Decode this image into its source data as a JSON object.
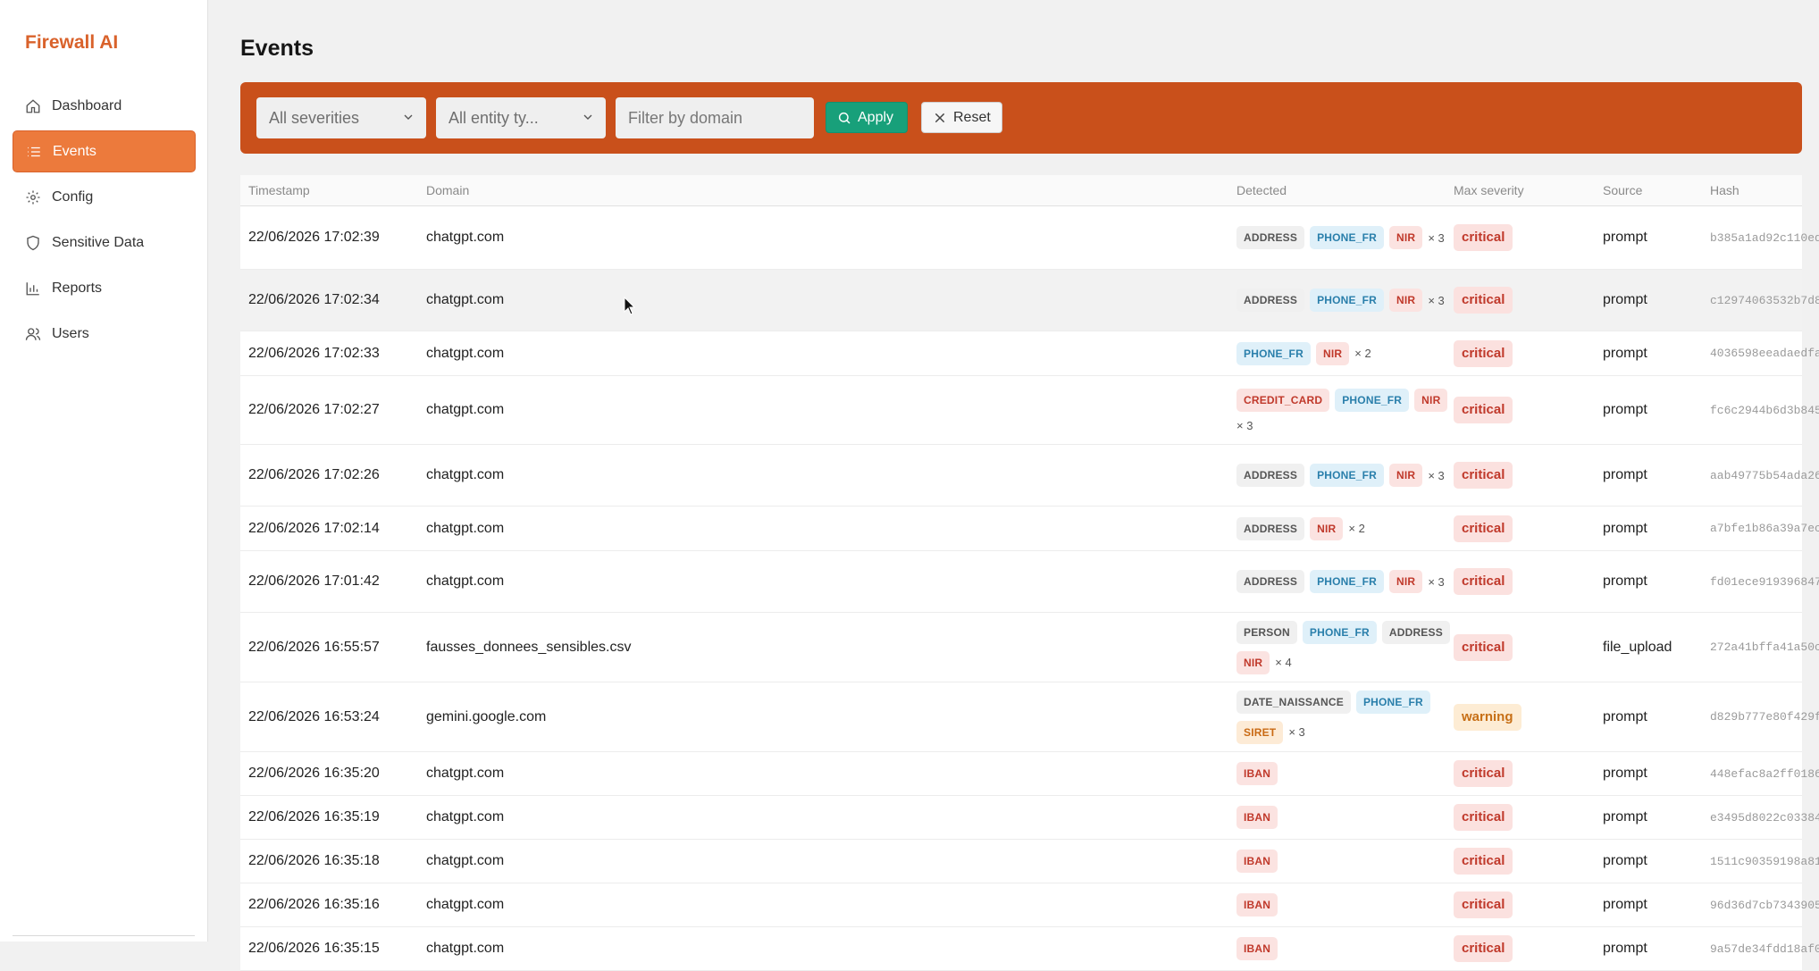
{
  "app": {
    "brand": "Firewall AI"
  },
  "sidebar": {
    "items": [
      {
        "label": "Dashboard",
        "icon": "home-icon",
        "active": false
      },
      {
        "label": "Events",
        "icon": "list-icon",
        "active": true
      },
      {
        "label": "Config",
        "icon": "gear-icon",
        "active": false
      },
      {
        "label": "Sensitive Data",
        "icon": "shield-icon",
        "active": false
      },
      {
        "label": "Reports",
        "icon": "bar-chart-icon",
        "active": false
      },
      {
        "label": "Users",
        "icon": "users-icon",
        "active": false
      }
    ]
  },
  "page": {
    "title": "Events"
  },
  "filters": {
    "severity_select": "All severities",
    "entity_select": "All entity ty...",
    "domain_placeholder": "Filter by domain",
    "apply_label": "Apply",
    "reset_label": "Reset"
  },
  "table": {
    "headers": {
      "timestamp": "Timestamp",
      "domain": "Domain",
      "detected": "Detected",
      "severity": "Max severity",
      "source": "Source",
      "hash": "Hash"
    },
    "rows": [
      {
        "timestamp": "22/06/2026 17:02:39",
        "domain": "chatgpt.com",
        "tags": [
          "ADDRESS",
          "PHONE_FR",
          "NIR"
        ],
        "count": "× 3",
        "severity": "critical",
        "source": "prompt",
        "hash": "b385a1ad92c110ed"
      },
      {
        "timestamp": "22/06/2026 17:02:34",
        "domain": "chatgpt.com",
        "tags": [
          "ADDRESS",
          "PHONE_FR",
          "NIR"
        ],
        "count": "× 3",
        "severity": "critical",
        "source": "prompt",
        "hash": "c12974063532b7d8"
      },
      {
        "timestamp": "22/06/2026 17:02:33",
        "domain": "chatgpt.com",
        "tags": [
          "PHONE_FR",
          "NIR"
        ],
        "count": "× 2",
        "severity": "critical",
        "source": "prompt",
        "hash": "4036598eeadaedfa"
      },
      {
        "timestamp": "22/06/2026 17:02:27",
        "domain": "chatgpt.com",
        "tags": [
          "CREDIT_CARD",
          "PHONE_FR",
          "NIR"
        ],
        "count": "× 3",
        "severity": "critical",
        "source": "prompt",
        "hash": "fc6c2944b6d3b845"
      },
      {
        "timestamp": "22/06/2026 17:02:26",
        "domain": "chatgpt.com",
        "tags": [
          "ADDRESS",
          "PHONE_FR",
          "NIR"
        ],
        "count": "× 3",
        "severity": "critical",
        "source": "prompt",
        "hash": "aab49775b54ada26"
      },
      {
        "timestamp": "22/06/2026 17:02:14",
        "domain": "chatgpt.com",
        "tags": [
          "ADDRESS",
          "NIR"
        ],
        "count": "× 2",
        "severity": "critical",
        "source": "prompt",
        "hash": "a7bfe1b86a39a7ec"
      },
      {
        "timestamp": "22/06/2026 17:01:42",
        "domain": "chatgpt.com",
        "tags": [
          "ADDRESS",
          "PHONE_FR",
          "NIR"
        ],
        "count": "× 3",
        "severity": "critical",
        "source": "prompt",
        "hash": "fd01ece919396847"
      },
      {
        "timestamp": "22/06/2026 16:55:57",
        "domain": "fausses_donnees_sensibles.csv",
        "tags": [
          "PERSON",
          "PHONE_FR",
          "ADDRESS",
          "NIR"
        ],
        "count": "× 4",
        "severity": "critical",
        "source": "file_upload",
        "hash": "272a41bffa41a50c"
      },
      {
        "timestamp": "22/06/2026 16:53:24",
        "domain": "gemini.google.com",
        "tags": [
          "DATE_NAISSANCE",
          "PHONE_FR",
          "SIRET"
        ],
        "count": "× 3",
        "severity": "warning",
        "source": "prompt",
        "hash": "d829b777e80f429f"
      },
      {
        "timestamp": "22/06/2026 16:35:20",
        "domain": "chatgpt.com",
        "tags": [
          "IBAN"
        ],
        "count": "",
        "severity": "critical",
        "source": "prompt",
        "hash": "448efac8a2ff0186"
      },
      {
        "timestamp": "22/06/2026 16:35:19",
        "domain": "chatgpt.com",
        "tags": [
          "IBAN"
        ],
        "count": "",
        "severity": "critical",
        "source": "prompt",
        "hash": "e3495d8022c03384"
      },
      {
        "timestamp": "22/06/2026 16:35:18",
        "domain": "chatgpt.com",
        "tags": [
          "IBAN"
        ],
        "count": "",
        "severity": "critical",
        "source": "prompt",
        "hash": "1511c90359198a81"
      },
      {
        "timestamp": "22/06/2026 16:35:16",
        "domain": "chatgpt.com",
        "tags": [
          "IBAN"
        ],
        "count": "",
        "severity": "critical",
        "source": "prompt",
        "hash": "96d36d7cb7343905"
      },
      {
        "timestamp": "22/06/2026 16:35:15",
        "domain": "chatgpt.com",
        "tags": [
          "IBAN"
        ],
        "count": "",
        "severity": "critical",
        "source": "prompt",
        "hash": "9a57de34fdd18af0"
      }
    ]
  },
  "tag_colors": {
    "ADDRESS": "gray",
    "PERSON": "gray",
    "DATE_NAISSANCE": "gray",
    "PHONE_FR": "blue",
    "NIR": "red",
    "CREDIT_CARD": "red",
    "IBAN": "red",
    "SIRET": "orange"
  },
  "colors": {
    "accent": "#c9501b",
    "apply": "#18a07a",
    "brand": "#d9622b"
  }
}
